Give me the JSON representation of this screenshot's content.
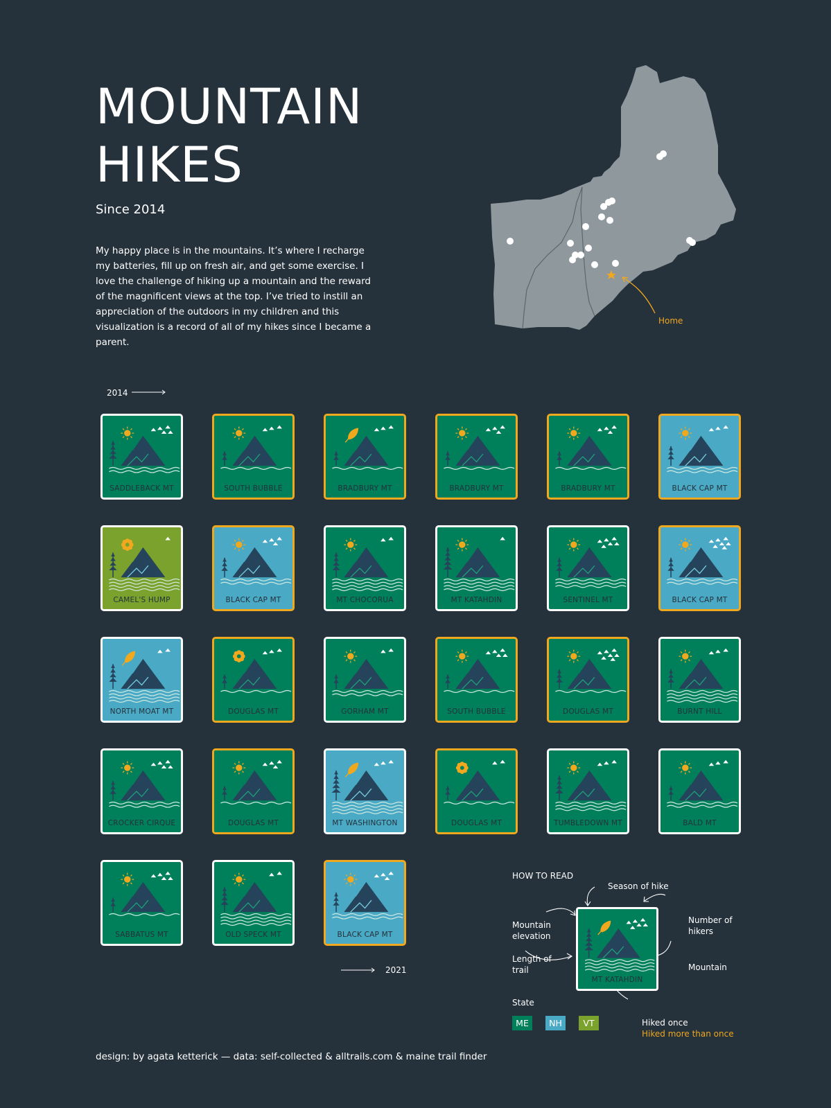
{
  "header": {
    "title_line1": "MOUNTAIN",
    "title_line2": "HIKES",
    "subtitle": "Since 2014",
    "intro": "My happy place is in the mountains. It’s where I recharge my batteries, fill up on fresh air, and get some exercise. I love the challenge of hiking up a mountain and the reward of the magnificent views at the top. I’ve tried to instill an appreciation of the outdoors in my children and this visualization is a record of all of my hikes since I became a parent."
  },
  "map": {
    "home_label": "Home",
    "land_color": "#8f989d",
    "home_color": "#f0a81e"
  },
  "timeline": {
    "start": "2014",
    "end": "2021"
  },
  "colors": {
    "ME": "#00805a",
    "NH": "#4aa9c4",
    "VT": "#7aa22c",
    "multi_border": "#f0a81e",
    "single_border": "#ffffff",
    "mountain": "#25435a",
    "background": "#25313b"
  },
  "hikes": [
    {
      "name": "SADDLEBACK MT",
      "state": "ME",
      "multi": false,
      "season": "summer",
      "hikers": 5,
      "elevation": 3,
      "length": 2
    },
    {
      "name": "SOUTH BUBBLE",
      "state": "ME",
      "multi": true,
      "season": "summer",
      "hikers": 3,
      "elevation": 1,
      "length": 1
    },
    {
      "name": "BRADBURY MT",
      "state": "ME",
      "multi": true,
      "season": "fall",
      "hikers": 3,
      "elevation": 1,
      "length": 1
    },
    {
      "name": "BRADBURY MT",
      "state": "ME",
      "multi": true,
      "season": "summer",
      "hikers": 4,
      "elevation": 1,
      "length": 1
    },
    {
      "name": "BRADBURY MT",
      "state": "ME",
      "multi": true,
      "season": "summer",
      "hikers": 4,
      "elevation": 1,
      "length": 1
    },
    {
      "name": "BLACK CAP MT",
      "state": "NH",
      "multi": true,
      "season": "summer",
      "hikers": 3,
      "elevation": 2,
      "length": 2
    },
    {
      "name": "CAMEL'S HUMP",
      "state": "VT",
      "multi": false,
      "season": "spring",
      "hikers": 1,
      "elevation": 3,
      "length": 4
    },
    {
      "name": "BLACK CAP MT",
      "state": "NH",
      "multi": true,
      "season": "summer",
      "hikers": 4,
      "elevation": 2,
      "length": 2
    },
    {
      "name": "MT CHOCORUA",
      "state": "ME",
      "multi": false,
      "season": "summer",
      "hikers": 2,
      "elevation": 3,
      "length": 4
    },
    {
      "name": "MT KATAHDIN",
      "state": "ME",
      "multi": false,
      "season": "summer",
      "hikers": 1,
      "elevation": 4,
      "length": 4
    },
    {
      "name": "SENTINEL MT",
      "state": "ME",
      "multi": false,
      "season": "summer",
      "hikers": 6,
      "elevation": 2,
      "length": 3
    },
    {
      "name": "BLACK CAP MT",
      "state": "NH",
      "multi": true,
      "season": "summer",
      "hikers": 7,
      "elevation": 2,
      "length": 2
    },
    {
      "name": "NORTH MOAT MT",
      "state": "NH",
      "multi": false,
      "season": "fall",
      "hikers": 2,
      "elevation": 3,
      "length": 4
    },
    {
      "name": "DOUGLAS MT",
      "state": "ME",
      "multi": true,
      "season": "spring",
      "hikers": 3,
      "elevation": 1,
      "length": 1
    },
    {
      "name": "GORHAM MT",
      "state": "ME",
      "multi": false,
      "season": "summer",
      "hikers": 2,
      "elevation": 1,
      "length": 2
    },
    {
      "name": "SOUTH BUBBLE",
      "state": "ME",
      "multi": true,
      "season": "summer",
      "hikers": 5,
      "elevation": 1,
      "length": 1
    },
    {
      "name": "DOUGLAS MT",
      "state": "ME",
      "multi": true,
      "season": "summer",
      "hikers": 7,
      "elevation": 2,
      "length": 1
    },
    {
      "name": "BURNT HILL",
      "state": "ME",
      "multi": false,
      "season": "summer",
      "hikers": 3,
      "elevation": 2,
      "length": 4
    },
    {
      "name": "CROCKER CIRQUE",
      "state": "ME",
      "multi": false,
      "season": "summer",
      "hikers": 5,
      "elevation": 2,
      "length": 2
    },
    {
      "name": "DOUGLAS MT",
      "state": "ME",
      "multi": true,
      "season": "summer",
      "hikers": 4,
      "elevation": 1,
      "length": 1
    },
    {
      "name": "MT WASHINGTON",
      "state": "NH",
      "multi": false,
      "season": "fall",
      "hikers": 3,
      "elevation": 4,
      "length": 4
    },
    {
      "name": "DOUGLAS MT",
      "state": "ME",
      "multi": true,
      "season": "spring",
      "hikers": 2,
      "elevation": 1,
      "length": 1
    },
    {
      "name": "TUMBLEDOWN MT",
      "state": "ME",
      "multi": false,
      "season": "summer",
      "hikers": 3,
      "elevation": 3,
      "length": 3
    },
    {
      "name": "BALD MT",
      "state": "ME",
      "multi": false,
      "season": "summer",
      "hikers": 3,
      "elevation": 1,
      "length": 2
    },
    {
      "name": "SABBATUS MT",
      "state": "ME",
      "multi": false,
      "season": "summer",
      "hikers": 5,
      "elevation": 1,
      "length": 1
    },
    {
      "name": "OLD SPECK MT",
      "state": "ME",
      "multi": false,
      "season": "summer",
      "hikers": 2,
      "elevation": 3,
      "length": 4
    },
    {
      "name": "BLACK CAP MT",
      "state": "NH",
      "multi": true,
      "season": "summer",
      "hikers": 4,
      "elevation": 2,
      "length": 2
    }
  ],
  "legend": {
    "heading": "HOW TO READ",
    "season": "Season of hike",
    "hikers": "Number of hikers",
    "elevation": "Mountain elevation",
    "length": "Length of trail",
    "mountain": "Mountain",
    "example_name": "MT KATAHDIN",
    "state_label": "State",
    "states": [
      "ME",
      "NH",
      "VT"
    ],
    "once": "Hiked once",
    "more": "Hiked more than once"
  },
  "footer": {
    "credit": "design: by agata ketterick — data: self-collected & alltrails.com & maine trail finder"
  }
}
